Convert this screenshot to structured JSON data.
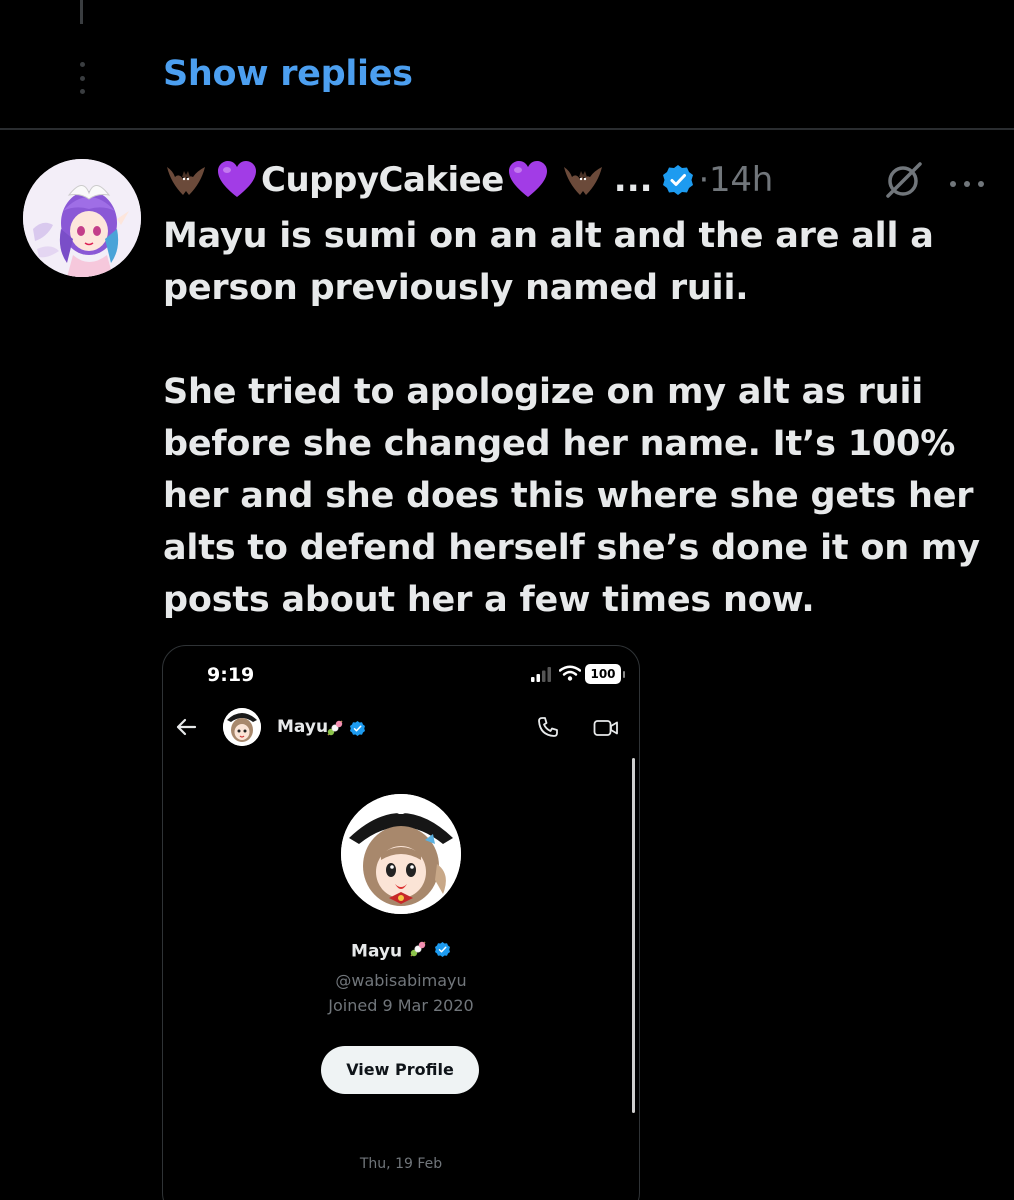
{
  "thread": {
    "show_replies_label": "Show replies"
  },
  "tweet": {
    "author": {
      "display_name": "CuppyCakiee",
      "truncation": "...",
      "verified": true
    },
    "timestamp": "14h",
    "timestamp_separator": "·",
    "text_paragraphs": [
      "Mayu is sumi on an alt and the are all a person previously named ruii.",
      "She tried to apologize on my alt as ruii before she changed her name. It’s 100% her and she does this where she gets her alts to defend herself she’s done it on my posts about her a few times now."
    ]
  },
  "embedded_screenshot": {
    "status_bar": {
      "time": "9:19",
      "battery": "100"
    },
    "chat_header": {
      "name": "Mayu"
    },
    "profile": {
      "name": "Mayu",
      "handle": "@wabisabimayu",
      "joined": "Joined 9 Mar 2020",
      "view_profile_label": "View Profile"
    },
    "date_separator": "Thu, 19 Feb"
  },
  "colors": {
    "background": "#000000",
    "link_blue": "#4c9ff0",
    "text_primary": "#e7e9ea",
    "text_secondary": "#71767b",
    "verified_blue": "#1d9bf0",
    "heart_purple": "#a23ce6"
  },
  "icons": {
    "emoji_1": "bat-emoji",
    "emoji_2": "purple-heart-emoji",
    "verified": "verified-badge-icon",
    "grok": "grok-icon",
    "more": "more-dots-icon"
  }
}
